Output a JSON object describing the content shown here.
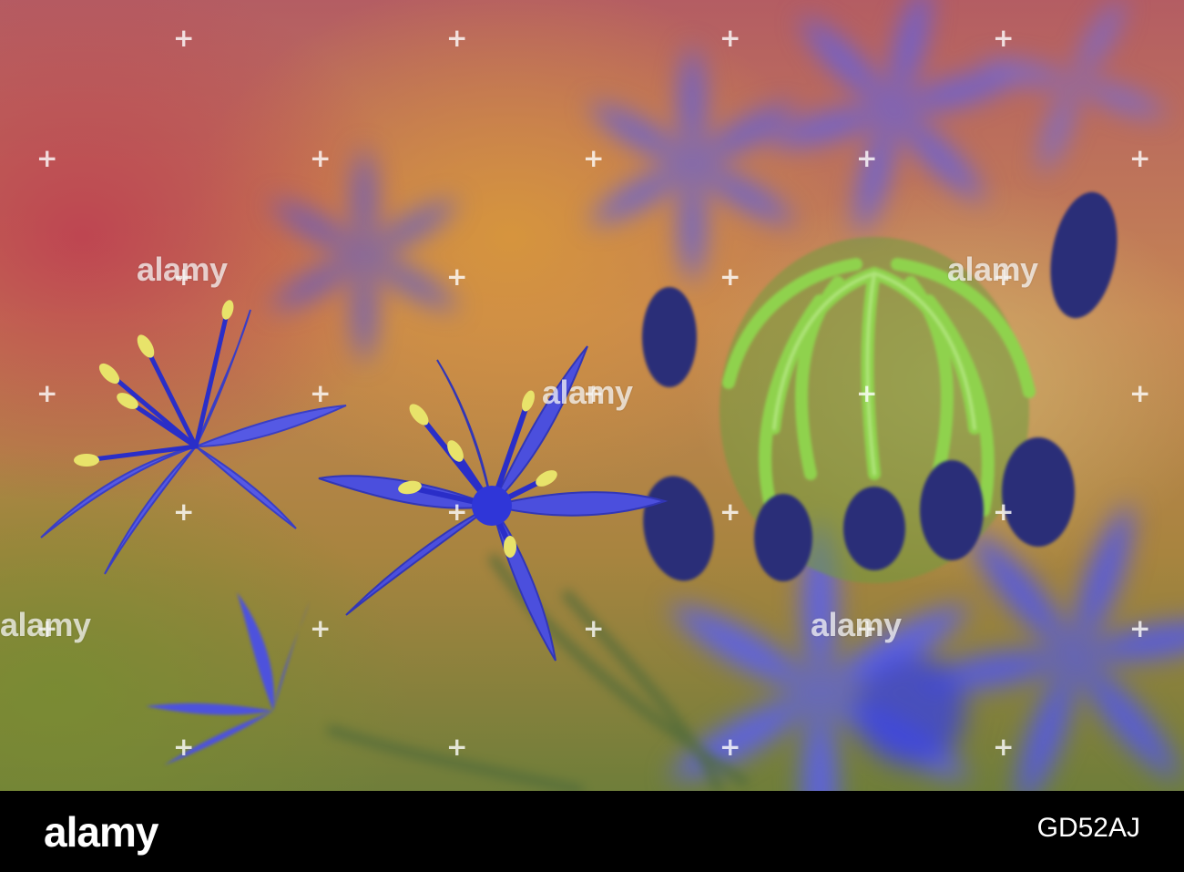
{
  "photo": {
    "subject": "blue-star-flowers-and-green-bud",
    "colors": {
      "petal_blue": "#4a4fe0",
      "petal_deep": "#2b2fb8",
      "bud_green": "#7ec843",
      "stamen_yellow": "#e8e36a",
      "bud_navy": "#2a2e78"
    }
  },
  "watermark": {
    "text": "alamy"
  },
  "footer": {
    "logo": "alamy",
    "image_id": "GD52AJ"
  }
}
